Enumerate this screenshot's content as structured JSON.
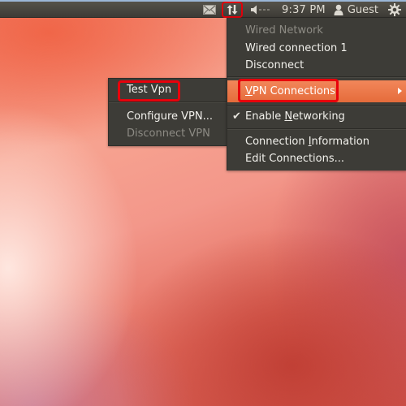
{
  "panel": {
    "indicators": [
      {
        "name": "mail-icon"
      },
      {
        "name": "network-updown-icon",
        "highlighted": true
      },
      {
        "name": "volume-icon"
      }
    ],
    "clock": "9:37 PM",
    "user": "Guest"
  },
  "network_menu": {
    "items": [
      {
        "label": "Wired Network",
        "disabled": true
      },
      {
        "label": "Wired connection 1"
      },
      {
        "label": "Disconnect"
      },
      {
        "label_pre": "",
        "label_ul": "V",
        "label_post": "PN Connections",
        "highlighted": true,
        "submenu": true
      },
      {
        "label_pre": "Enable ",
        "label_ul": "N",
        "label_post": "etworking",
        "checked": true
      },
      {
        "label_pre": "Connection ",
        "label_ul": "I",
        "label_post": "nformation"
      },
      {
        "label": "Edit Connections..."
      }
    ]
  },
  "vpn_submenu": {
    "items": [
      {
        "label": "Test Vpn"
      },
      {
        "label": "Configure VPN..."
      },
      {
        "label": "Disconnect VPN",
        "disabled": true
      }
    ]
  },
  "colors": {
    "highlight": "#e97a4a",
    "annotation_box": "#e8000b",
    "menu_bg": "#3d3c37"
  }
}
